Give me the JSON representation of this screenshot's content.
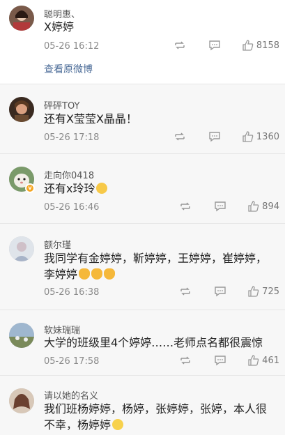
{
  "comments": [
    {
      "name": "聪明惠、",
      "text": "X婷婷",
      "time": "05-26 16:12",
      "likes": "8158",
      "view_original": "查看原微博"
    },
    {
      "name": "砰砰TOY",
      "text": "还有X莹莹X晶晶！",
      "time": "05-26 17:18",
      "likes": "1360"
    },
    {
      "name": "走向你0418",
      "text": "还有x玲玲",
      "time": "05-26 16:46",
      "likes": "894",
      "emoji": "crying-laughing-emoji"
    },
    {
      "name": "额尔瑾",
      "text": "我同学有金婷婷，靳婷婷，王婷婷，崔婷婷，李婷婷",
      "time": "05-26 16:38",
      "likes": "725",
      "emoji": "cat-emoji"
    },
    {
      "name": "软妹瑞瑞",
      "text": "大学的班级里4个婷婷……老师点名都很震惊",
      "time": "05-26 17:58",
      "likes": "461"
    },
    {
      "name": "请以她的名义",
      "text": "我们班杨婷婷，杨婷，张婷婷，张婷，本人很不幸，杨婷婷",
      "emoji": "shy-emoji"
    }
  ],
  "colors": {
    "link": "#4e6e99",
    "verified_badge": "#f5a623",
    "background": "#f2f2f2"
  },
  "icons": [
    "repost-icon",
    "comment-icon",
    "like-icon",
    "verified-icon"
  ]
}
